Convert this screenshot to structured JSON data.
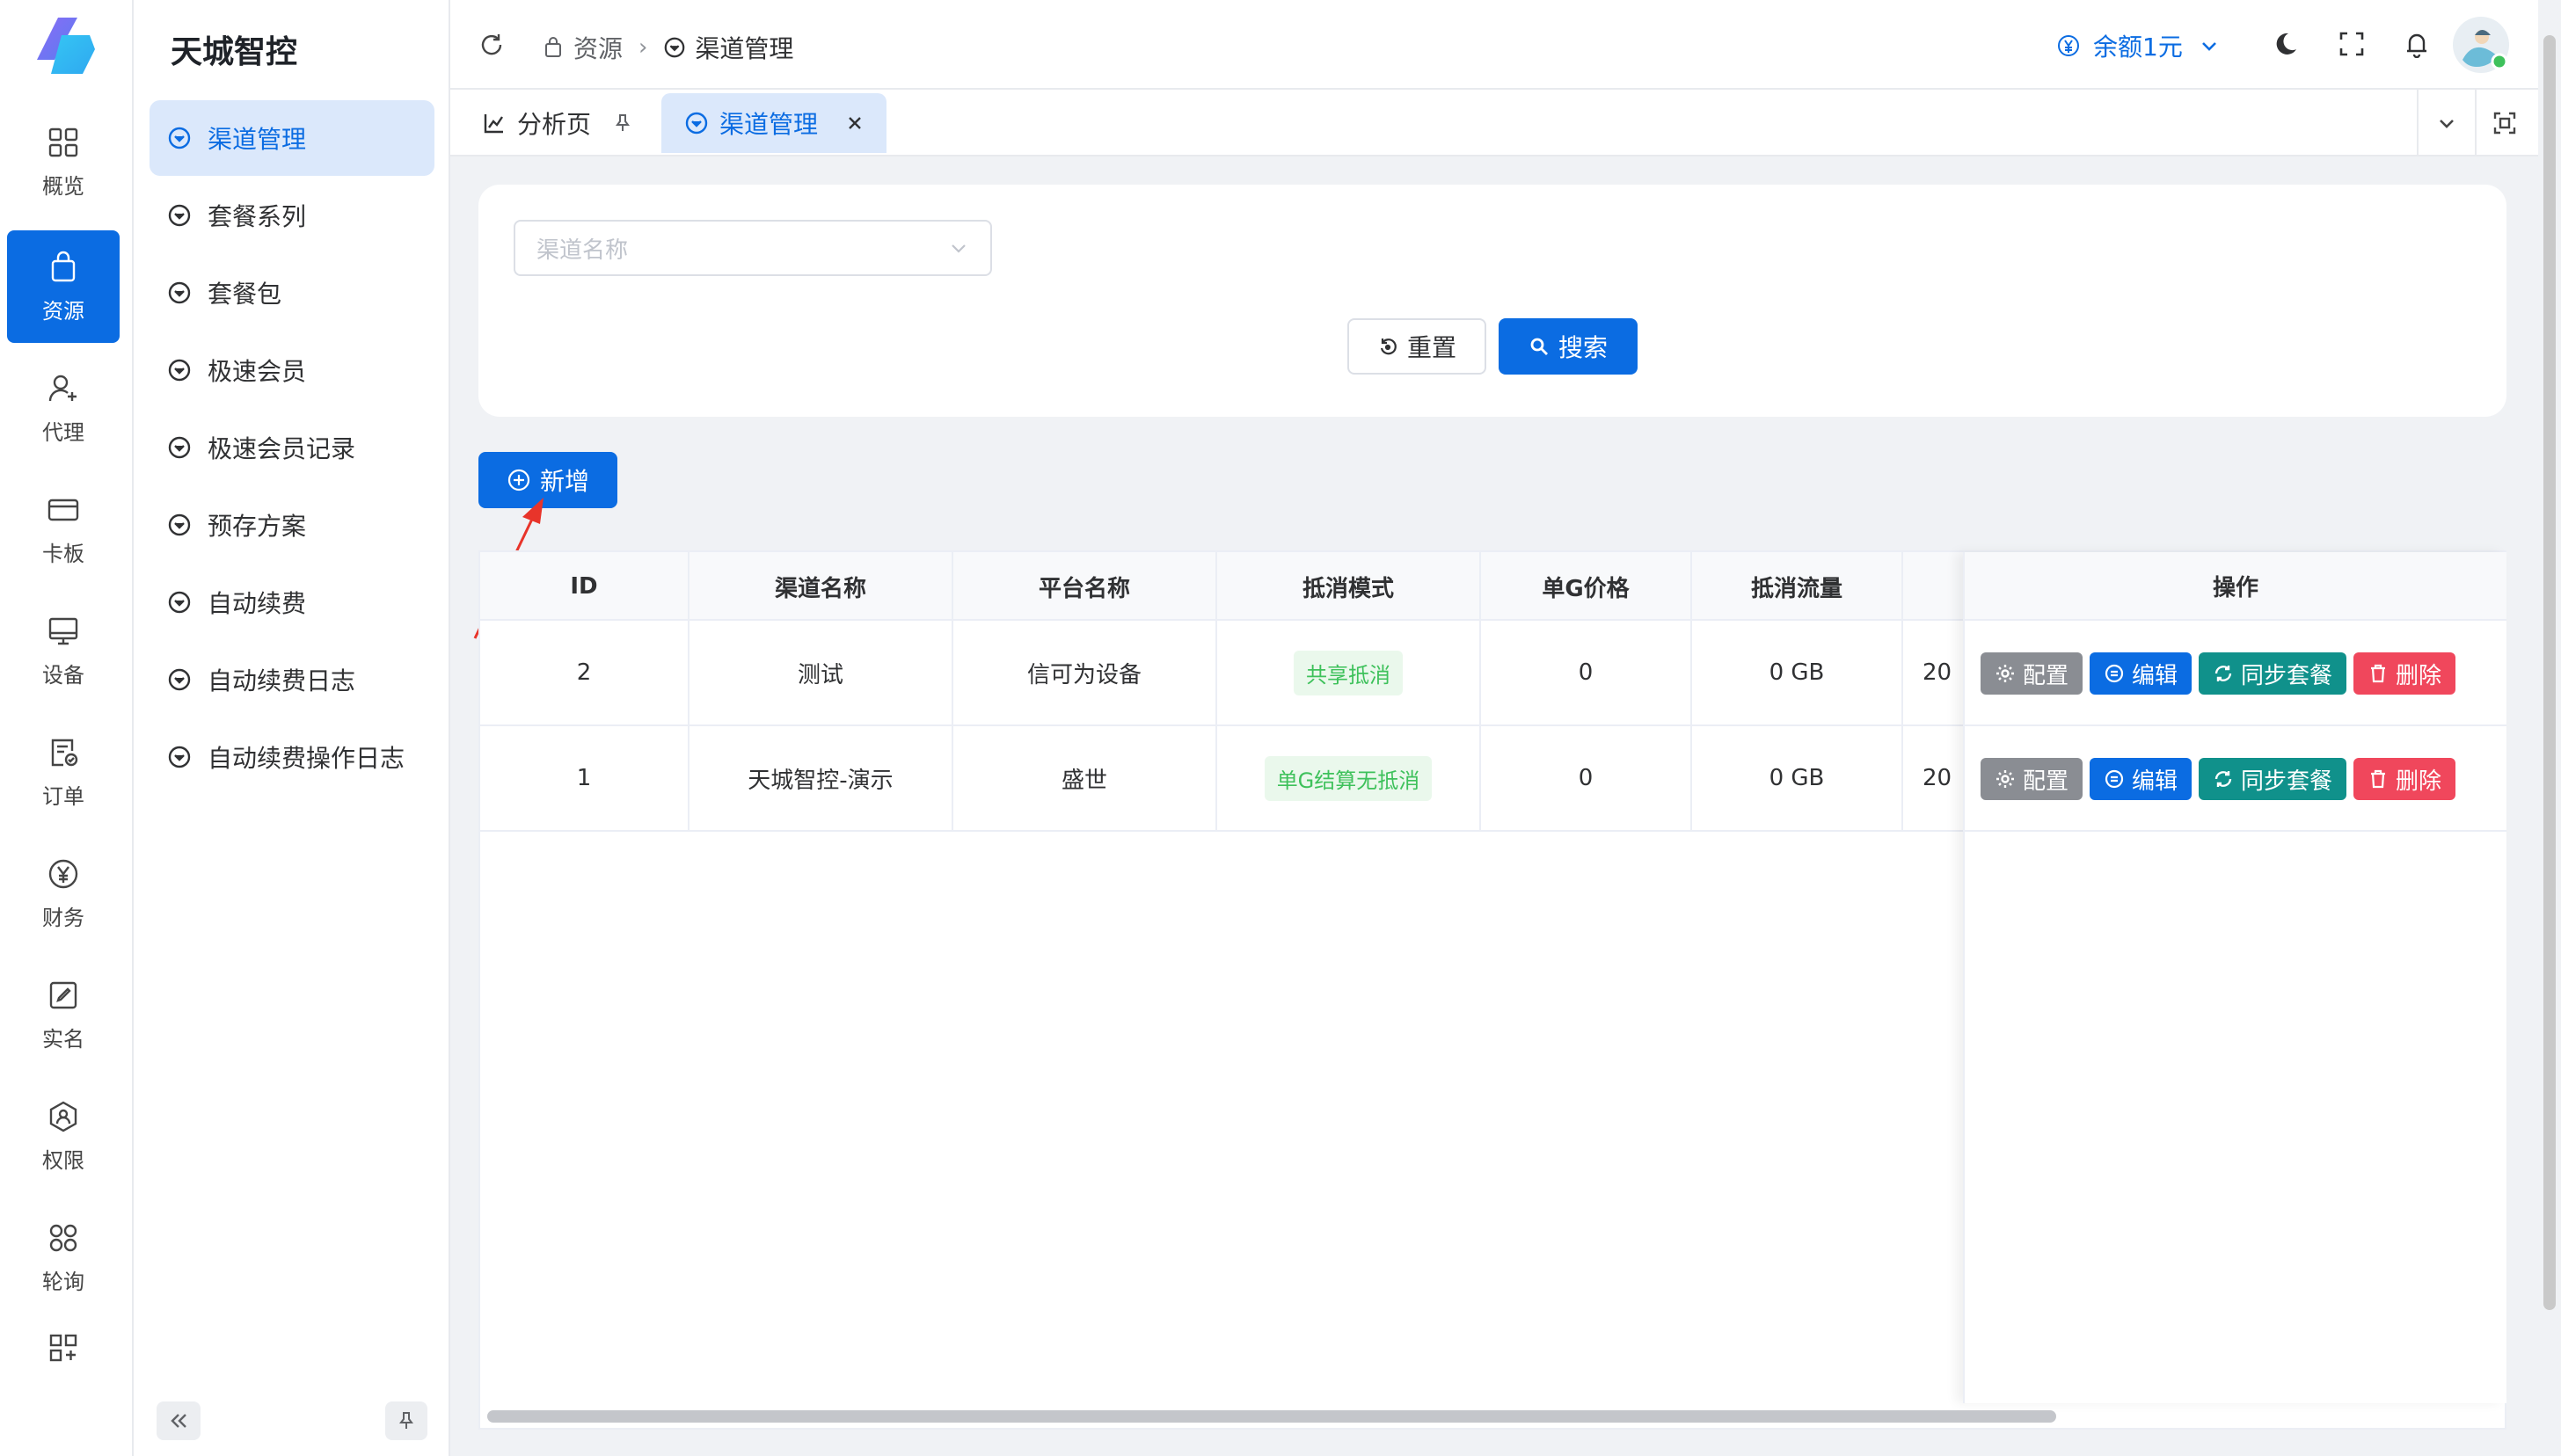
{
  "app": {
    "name": "天城智控"
  },
  "rail": {
    "items": [
      {
        "label": "概览",
        "icon": "dashboard-icon"
      },
      {
        "label": "资源",
        "icon": "bag-icon"
      },
      {
        "label": "代理",
        "icon": "user-add-icon"
      },
      {
        "label": "卡板",
        "icon": "card-icon"
      },
      {
        "label": "设备",
        "icon": "monitor-icon"
      },
      {
        "label": "订单",
        "icon": "order-icon"
      },
      {
        "label": "财务",
        "icon": "yen-icon"
      },
      {
        "label": "实名",
        "icon": "edit-icon"
      },
      {
        "label": "权限",
        "icon": "permission-icon"
      },
      {
        "label": "轮询",
        "icon": "cluster-icon"
      }
    ]
  },
  "submenu": {
    "items": [
      "渠道管理",
      "套餐系列",
      "套餐包",
      "极速会员",
      "极速会员记录",
      "预存方案",
      "自动续费",
      "自动续费日志",
      "自动续费操作日志"
    ]
  },
  "header": {
    "breadcrumb": {
      "parent": "资源",
      "current": "渠道管理"
    },
    "balance": "余额1元"
  },
  "tabs": [
    {
      "label": "分析页"
    },
    {
      "label": "渠道管理"
    }
  ],
  "search": {
    "channel_placeholder": "渠道名称",
    "reset_label": "重置",
    "search_label": "搜索"
  },
  "toolbar": {
    "add_label": "新增"
  },
  "table": {
    "columns": [
      "ID",
      "渠道名称",
      "平台名称",
      "抵消模式",
      "单G价格",
      "抵消流量"
    ],
    "ops_header": "操作",
    "rows": [
      {
        "id": "2",
        "channel": "测试",
        "platform": "信可为设备",
        "mode": "共享抵消",
        "price": "0",
        "traffic": "0 GB",
        "extra": "20"
      },
      {
        "id": "1",
        "channel": "天城智控-演示",
        "platform": "盛世",
        "mode": "单G结算无抵消",
        "price": "0",
        "traffic": "0 GB",
        "extra": "20"
      }
    ],
    "actions": {
      "config": "配置",
      "edit": "编辑",
      "sync": "同步套餐",
      "delete": "删除"
    }
  },
  "colors": {
    "primary": "#0b6ce2",
    "teal": "#10918b",
    "danger": "#f0475c",
    "gray": "#8a8d93",
    "tag_green": "#3ec15b"
  }
}
